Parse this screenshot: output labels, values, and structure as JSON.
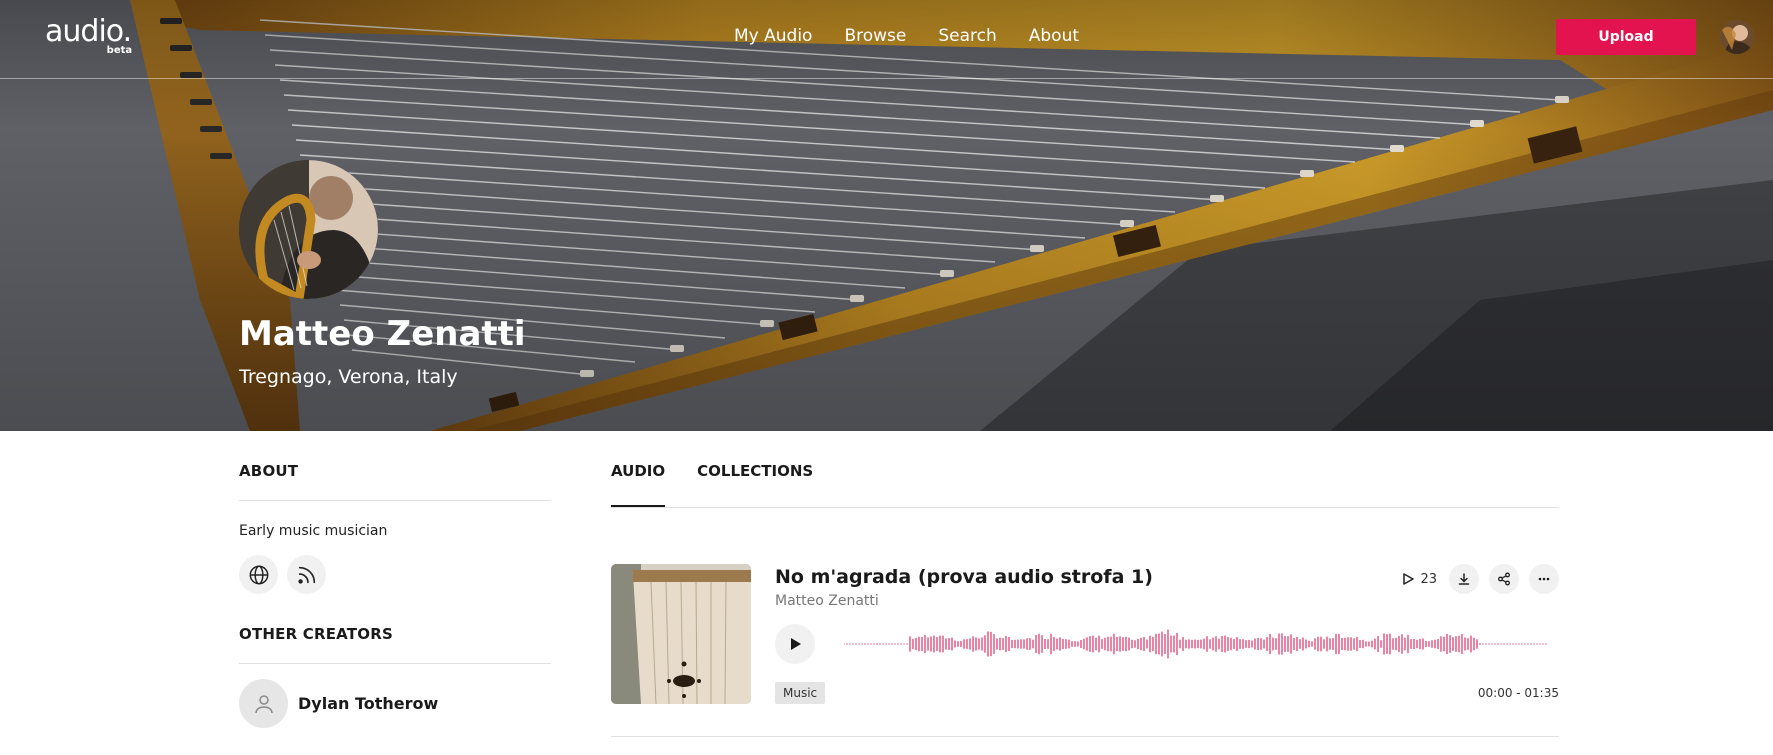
{
  "header": {
    "logo_text": "audio.",
    "logo_badge": "beta",
    "nav": [
      "My Audio",
      "Browse",
      "Search",
      "About"
    ],
    "upload_label": "Upload"
  },
  "profile": {
    "name": "Matteo Zenatti",
    "location": "Tregnago, Verona, Italy"
  },
  "sidebar": {
    "about_heading": "ABOUT",
    "about_text": "Early music musician",
    "social_icons": [
      "globe-icon",
      "rss-icon"
    ],
    "other_creators_heading": "OTHER CREATORS",
    "creators": [
      {
        "name": "Dylan Totherow"
      }
    ]
  },
  "tabs": [
    {
      "label": "AUDIO",
      "active": true
    },
    {
      "label": "COLLECTIONS",
      "active": false
    }
  ],
  "tracks": [
    {
      "title": "No m'agrada (prova audio strofa 1)",
      "artist": "Matteo Zenatti",
      "plays": "23",
      "tag": "Music",
      "duration": "00:00 - 01:35"
    }
  ],
  "colors": {
    "accent": "#e3134f",
    "waveform": "#e0416f"
  }
}
